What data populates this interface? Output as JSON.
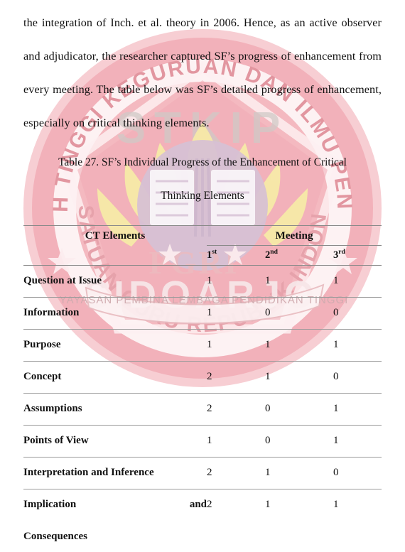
{
  "paragraph": {
    "text": "the integration of Inch. et al. theory in 2006. Hence, as an active observer and adjudicator, the researcher captured SF’s progress of enhancement from every meeting. The table below was SF’s detailed progress of enhancement, especially on critical thinking elements."
  },
  "caption": {
    "line1": "Table 27. SF’s Individual Progress of the Enhancement of Critical",
    "line2": "Thinking Elements"
  },
  "table": {
    "header": {
      "elements_label": "CT Elements",
      "meeting_label": "Meeting",
      "meeting_columns": [
        {
          "number": "1",
          "ordinal": "st"
        },
        {
          "number": "2",
          "ordinal": "nd"
        },
        {
          "number": "3",
          "ordinal": "rd"
        }
      ]
    },
    "rows": [
      {
        "element": "Question at Issue",
        "m1": "1",
        "m2": "1",
        "m3": "1"
      },
      {
        "element": "Information",
        "m1": "1",
        "m2": "0",
        "m3": "0"
      },
      {
        "element": "Purpose",
        "m1": "1",
        "m2": "1",
        "m3": "1"
      },
      {
        "element": "Concept",
        "m1": "2",
        "m2": "1",
        "m3": "0"
      },
      {
        "element": "Assumptions",
        "m1": "2",
        "m2": "0",
        "m3": "1"
      },
      {
        "element": "Points of View",
        "m1": "1",
        "m2": "0",
        "m3": "1"
      },
      {
        "element": "Interpretation and Inference",
        "m1": "2",
        "m2": "1",
        "m3": "0"
      },
      {
        "element": "Implication and",
        "element_wrap": "Consequences",
        "m1": "2",
        "m2": "1",
        "m3": "1"
      }
    ]
  },
  "watermark": {
    "name": "stkip-pgri-sidoarjo-seal",
    "outer_text_top": "SEKOLAH TINGGI KEGURUAN DAN ILMU PENDIDIKAN",
    "outer_text_bottom": "PERSATUAN GURU REPUBLIK INDONESIA",
    "acronym": "STKIP",
    "city": "SIDOARJO",
    "center_mark": "PGRI",
    "ribbon_text": "YAYASAN PEMBINA LEMBAGA PENDIDIKAN TINGGI",
    "colors": {
      "ring": "#f4b9bf",
      "ring_deep": "#eda3ab",
      "pale": "#fbe0e3",
      "flame": "#f6e9a8",
      "center": "#d8c3d8",
      "paper": "#ffffff"
    }
  }
}
